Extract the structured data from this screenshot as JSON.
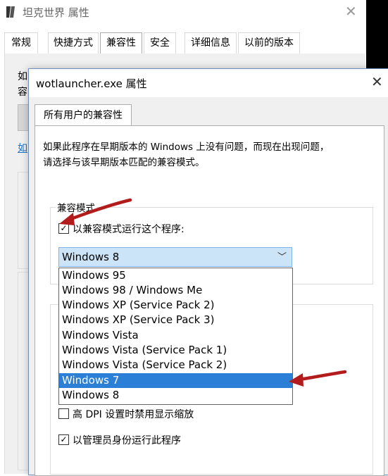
{
  "background_window": {
    "title": "坦克世界 属性",
    "close_glyph": "✕",
    "tabs": [
      "常规",
      "快捷方式",
      "兼容性",
      "安全",
      "详细信息",
      "以前的版本"
    ],
    "active_tab_index": 2,
    "fragments": [
      "如",
      "容",
      "如"
    ]
  },
  "dialog": {
    "title": "wotlauncher.exe 属性",
    "close_glyph": "✕",
    "tab_label": "所有用户的兼容性",
    "description_line1": "如果此程序在早期版本的 Windows 上没有问题，而现在出现问题，",
    "description_line2": "请选择与该早期版本匹配的兼容模式。",
    "compat_group_label": "兼容模式",
    "compat_checkbox_label": "以兼容模式运行这个程序:",
    "compat_checkbox_checked": true,
    "combo_value": "Windows 8",
    "dropdown_options": [
      "Windows 95",
      "Windows 98 / Windows Me",
      "Windows XP (Service Pack 2)",
      "Windows XP (Service Pack 3)",
      "Windows Vista",
      "Windows Vista (Service Pack 1)",
      "Windows Vista (Service Pack 2)",
      "Windows 7",
      "Windows 8"
    ],
    "highlighted_option": "Windows 7",
    "dpi_checkbox_label": "高 DPI 设置时禁用显示缩放",
    "dpi_checkbox_checked": false,
    "admin_checkbox_label": "以管理员身份运行此程序",
    "admin_checkbox_checked": true
  },
  "colors": {
    "highlight": "#2b7fd6",
    "annotation_arrow": "#b31c1c",
    "combo_background": "#cce4f7"
  }
}
